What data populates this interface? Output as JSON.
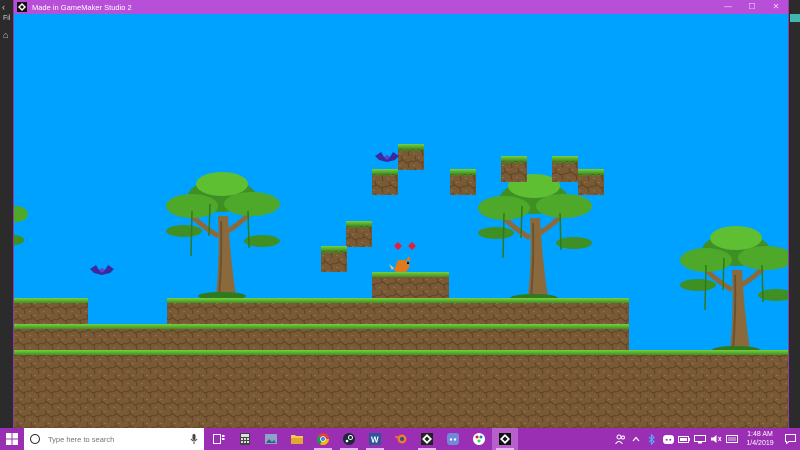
{
  "window": {
    "title": "Made in GameMaker Studio 2",
    "minimize_glyph": "—",
    "maximize_glyph": "☐",
    "close_glyph": "✕",
    "app_icon": "gamemaker-icon"
  },
  "ide": {
    "menu_fragment": "Fil",
    "home_icon": "home-icon"
  },
  "game": {
    "sky_color": "#00a2ff",
    "grass_color": "#4ea82a",
    "dirt_color": "#7a5a35",
    "enemies": [
      "bat",
      "bat"
    ],
    "player": "fox",
    "pickups": [
      "gem",
      "gem"
    ]
  },
  "taskbar": {
    "search_placeholder": "Type here to search",
    "apps": [
      "task-view-icon",
      "calculator-icon",
      "photos-icon",
      "file-explorer-icon",
      "chrome-icon",
      "steam-icon",
      "word-icon",
      "blender-icon",
      "gamemaker-icon",
      "discord-icon",
      "paint-icon",
      "gamemaker-runner-icon"
    ],
    "tray_icons": [
      "people-icon",
      "chevron-up-icon",
      "bluetooth-icon",
      "discord-tray-icon",
      "battery-icon",
      "network-icon",
      "volume-icon",
      "keyboard-icon"
    ],
    "time": "1:48 AM",
    "date": "1/4/2019",
    "accent": "#9b2fb3"
  }
}
